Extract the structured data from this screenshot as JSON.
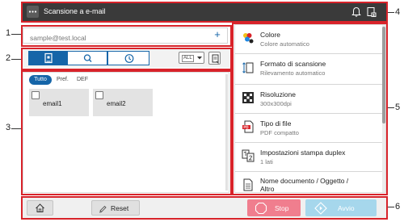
{
  "callouts": [
    "1",
    "2",
    "3",
    "4",
    "5",
    "6"
  ],
  "topbar": {
    "menu_icon": "ellipsis-icon",
    "title": "Scansione a e-mail",
    "icons": [
      "bell-icon",
      "job-status-icon"
    ]
  },
  "destination": {
    "placeholder": "sample@test.local",
    "add_label": "+"
  },
  "toolbar": {
    "view_icons": [
      "address-book-icon",
      "search-icon",
      "history-icon"
    ],
    "filter_label": "ALL",
    "filter_icon": "chevron-down-icon",
    "fav_icon": "favorite-icon"
  },
  "address_list": {
    "tabs": [
      "Tutto",
      "Pref.",
      "DEF"
    ],
    "entries": [
      "email1",
      "email2"
    ]
  },
  "settings": {
    "items": [
      {
        "title": "Colore",
        "value": "Colore automatico",
        "icon": "color-icon"
      },
      {
        "title": "Formato di scansione",
        "value": "Rilevamento automatico",
        "icon": "scan-size-icon"
      },
      {
        "title": "Risoluzione",
        "value": "300x300dpi",
        "icon": "resolution-icon"
      },
      {
        "title": "Tipo di file",
        "value": "PDF compatto",
        "icon": "pdf-file-icon"
      },
      {
        "title": "Impostazioni stampa duplex",
        "value": "1 lati",
        "icon": "duplex-icon"
      },
      {
        "title": "Nome documento / Oggetto /",
        "value": "Altro",
        "icon": "document-icon"
      }
    ]
  },
  "bottom": {
    "home_icon": "home-icon",
    "reset_label": "Reset",
    "stop_label": "Stop",
    "start_label": "Avvio"
  },
  "colors": {
    "accent": "#1565a8",
    "stop": "#f07e8e",
    "start": "#a6d7ec",
    "frame": "#d8232a",
    "topbar": "#3a3a3a"
  }
}
